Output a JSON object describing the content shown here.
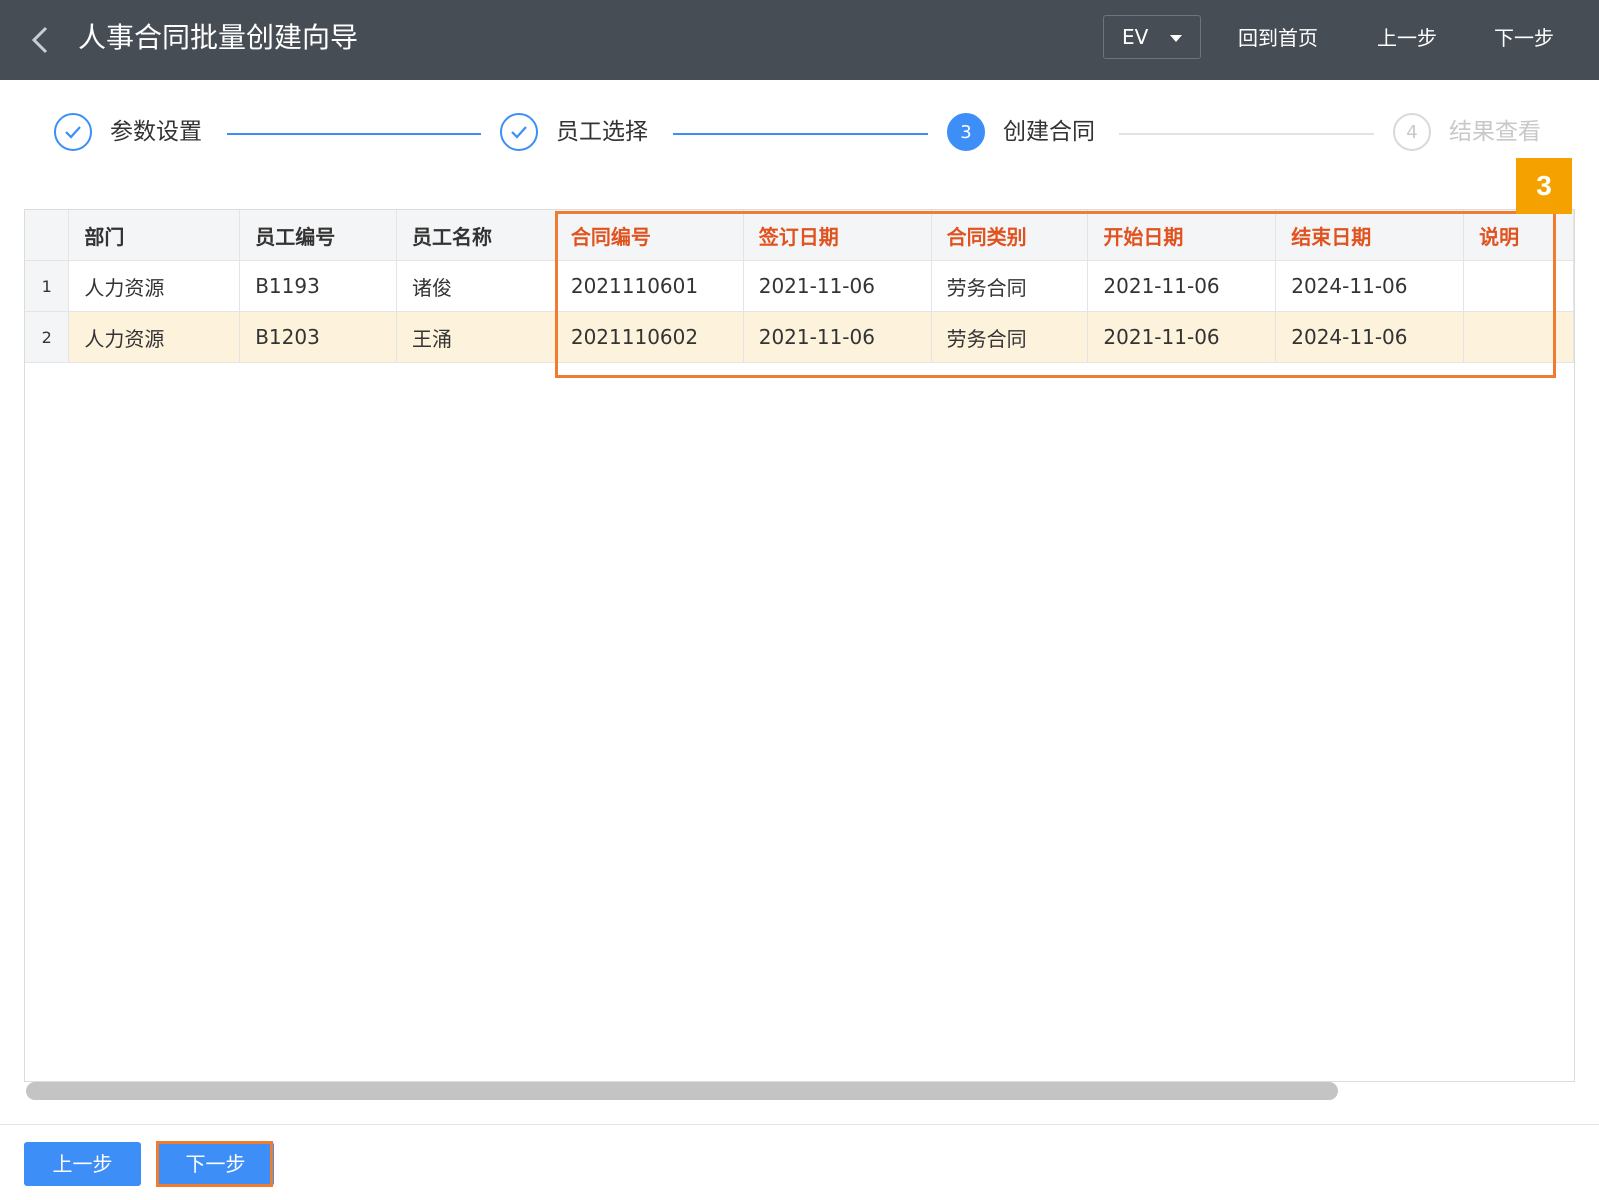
{
  "header": {
    "title": "人事合同批量创建向导",
    "select_value": "EV",
    "home_label": "回到首页",
    "prev_label": "上一步",
    "next_label": "下一步"
  },
  "steps": [
    {
      "label": "参数设置",
      "state": "done",
      "num": ""
    },
    {
      "label": "员工选择",
      "state": "done",
      "num": ""
    },
    {
      "label": "创建合同",
      "state": "active",
      "num": "3"
    },
    {
      "label": "结果查看",
      "state": "todo",
      "num": "4"
    }
  ],
  "grid": {
    "columns": [
      "部门",
      "员工编号",
      "员工名称",
      "合同编号",
      "签订日期",
      "合同类别",
      "开始日期",
      "结束日期",
      "说明"
    ],
    "rows": [
      {
        "num": "1",
        "cells": [
          "人力资源",
          "B1193",
          "诸俊",
          "2021110601",
          "2021-11-06",
          "劳务合同",
          "2021-11-06",
          "2024-11-06",
          ""
        ]
      },
      {
        "num": "2",
        "cells": [
          "人力资源",
          "B1203",
          "王涌",
          "2021110602",
          "2021-11-06",
          "劳务合同",
          "2021-11-06",
          "2024-11-06",
          ""
        ]
      }
    ]
  },
  "annotation": {
    "badge": "3"
  },
  "footer": {
    "prev_label": "上一步",
    "next_label": "下一步"
  },
  "colors": {
    "header_bg": "#474d55",
    "accent": "#3e8ef7",
    "highlight": "#ef7d31",
    "header_text_highlight": "#e0531f",
    "badge": "#f5a200",
    "selected_row": "#fdf2dc"
  }
}
